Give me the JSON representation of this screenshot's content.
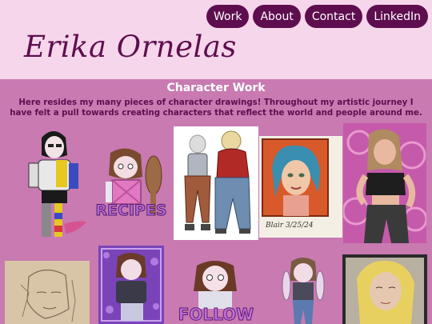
{
  "nav": {
    "items": [
      {
        "label": "Work"
      },
      {
        "label": "About"
      },
      {
        "label": "Contact"
      },
      {
        "label": "LinkedIn"
      }
    ]
  },
  "header": {
    "title": "Erika Ornelas"
  },
  "gallery": {
    "heading": "Character Work",
    "description": "Here resides my many pieces of character drawings! Throughout my artistic journey I have felt a pull towards creating characters that reflect the world and people around me.",
    "artworks": {
      "recipes_sticker_text": "RECIPES",
      "portrait_signature": "Blair 3/25/24",
      "follow_sticker_text": "FOLLOW"
    }
  },
  "colors": {
    "header_bg": "#f6d6ea",
    "accent": "#5e0e4f",
    "gallery_bg": "#c87ab1"
  }
}
